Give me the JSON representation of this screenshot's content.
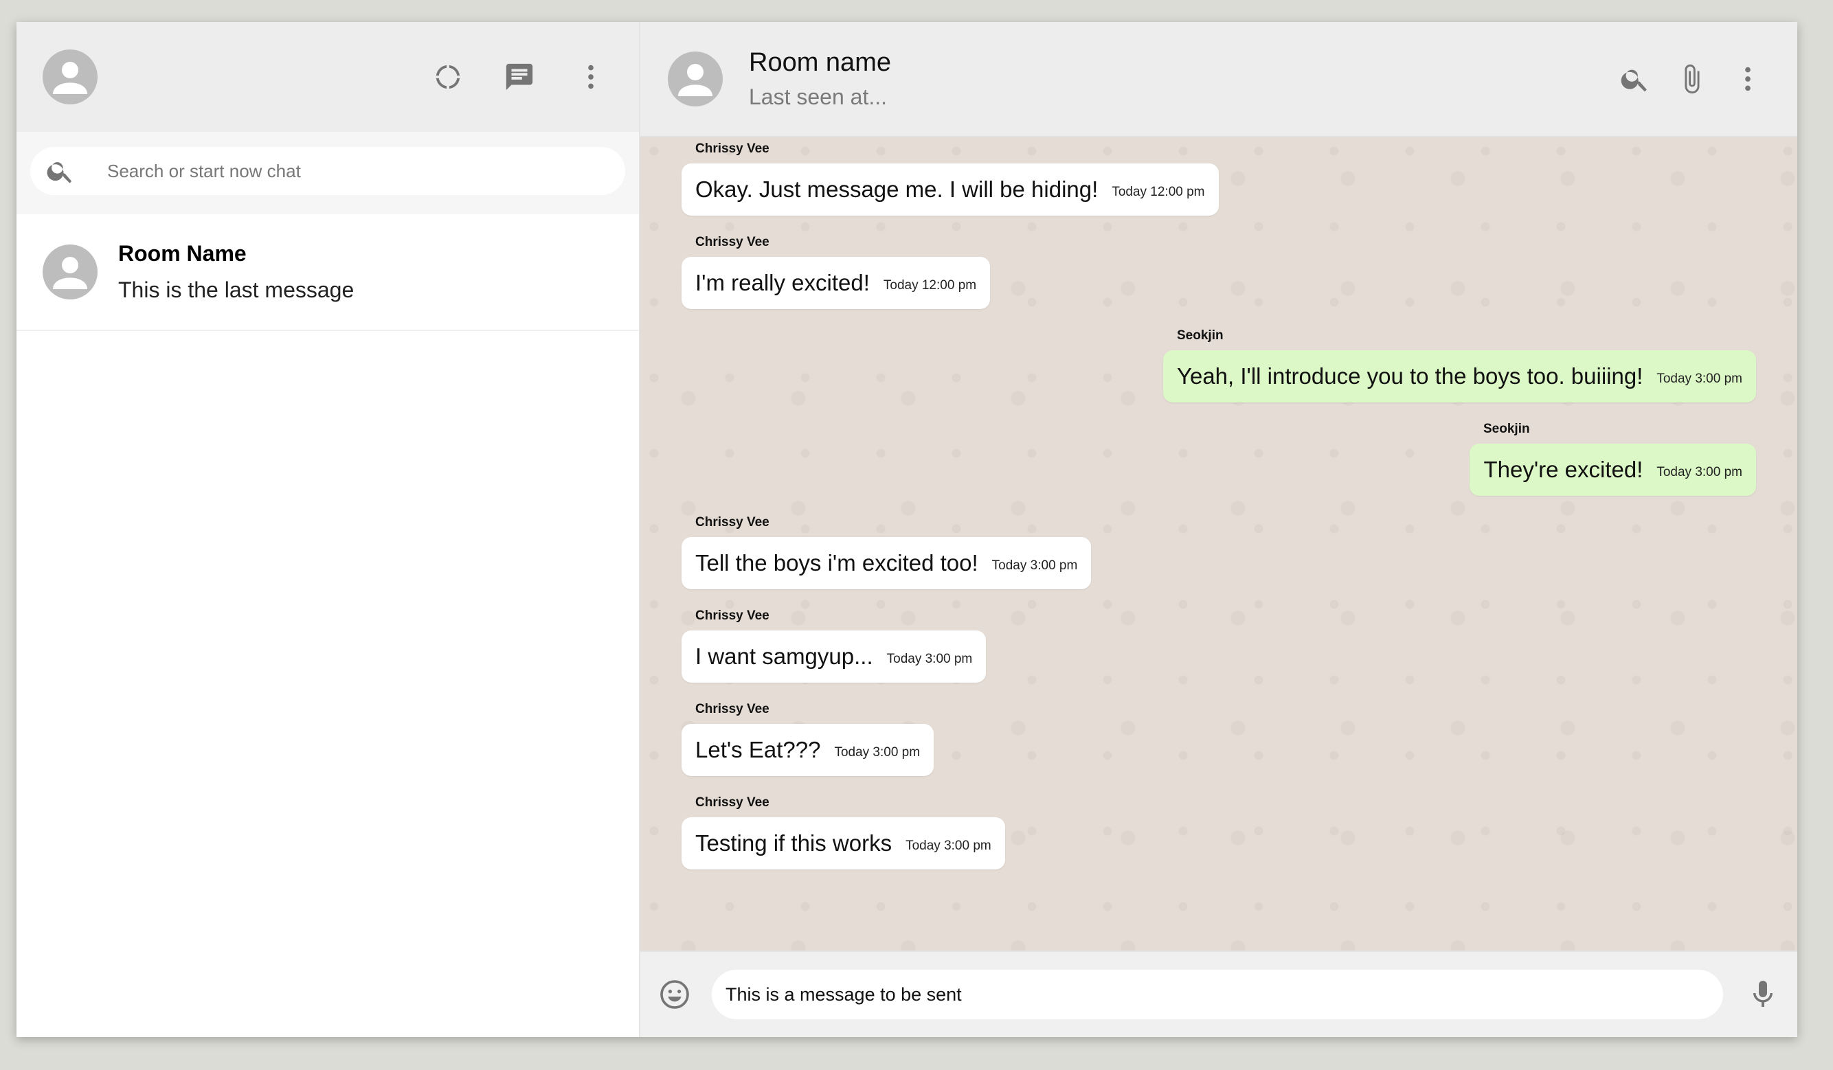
{
  "colors": {
    "header_bg": "#ededed",
    "chat_bg": "#e5ddd5",
    "sent_bubble": "#dcf8c6",
    "received_bubble": "#ffffff",
    "icon_gray": "#757575",
    "avatar_gray": "#bdbdbd"
  },
  "sidebar": {
    "icons": [
      "avatar",
      "status-icon",
      "chat-icon",
      "more-vert-icon"
    ],
    "search": {
      "placeholder": "Search or start now chat",
      "value": ""
    },
    "chats": [
      {
        "name": "Room Name",
        "last_message": "This is the last message"
      }
    ]
  },
  "chat": {
    "header": {
      "room_name": "Room name",
      "status": "Last seen at..."
    },
    "header_icons": [
      "search-icon",
      "attach-icon",
      "more-vert-icon"
    ],
    "messages": [
      {
        "sender": "Chrissy Vee",
        "text": "Okay. Just message me. I will be hiding!",
        "time": "Today 12:00 pm",
        "direction": "received"
      },
      {
        "sender": "Chrissy Vee",
        "text": "I'm really excited!",
        "time": "Today 12:00 pm",
        "direction": "received"
      },
      {
        "sender": "Seokjin",
        "text": "Yeah, I'll introduce you to the boys too. buiiing!",
        "time": "Today 3:00 pm",
        "direction": "sent"
      },
      {
        "sender": "Seokjin",
        "text": "They're excited!",
        "time": "Today 3:00 pm",
        "direction": "sent"
      },
      {
        "sender": "Chrissy Vee",
        "text": "Tell the boys i'm excited too!",
        "time": "Today 3:00 pm",
        "direction": "received"
      },
      {
        "sender": "Chrissy Vee",
        "text": "I want samgyup...",
        "time": "Today 3:00 pm",
        "direction": "received"
      },
      {
        "sender": "Chrissy Vee",
        "text": "Let's Eat???",
        "time": "Today 3:00 pm",
        "direction": "received"
      },
      {
        "sender": "Chrissy Vee",
        "text": "Testing if this works",
        "time": "Today 3:00 pm",
        "direction": "received"
      }
    ],
    "footer": {
      "input_value": "This is a message to be sent"
    }
  }
}
